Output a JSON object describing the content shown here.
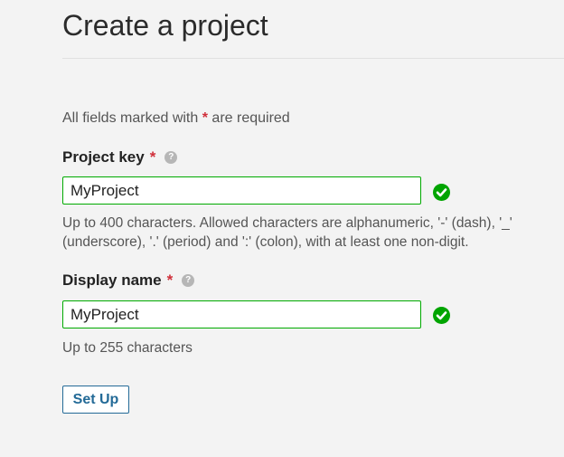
{
  "page": {
    "title": "Create a project"
  },
  "form": {
    "required_note_prefix": "All fields marked with",
    "required_note_asterisk": "*",
    "required_note_suffix": "are required",
    "project_key": {
      "label": "Project key",
      "required_marker": "*",
      "help_icon": "question-circle-icon",
      "value": "MyProject",
      "valid_icon": "check-circle-icon",
      "hint": "Up to 400 characters. Allowed characters are alphanumeric, '-' (dash), '_' (underscore), '.' (period) and ':' (colon), with at least one non-digit."
    },
    "display_name": {
      "label": "Display name",
      "required_marker": "*",
      "help_icon": "question-circle-icon",
      "value": "MyProject",
      "valid_icon": "check-circle-icon",
      "hint": "Up to 255 characters"
    },
    "submit_label": "Set Up"
  },
  "colors": {
    "valid": "#00a400",
    "required": "#d02f3a",
    "button": "#236a97"
  }
}
